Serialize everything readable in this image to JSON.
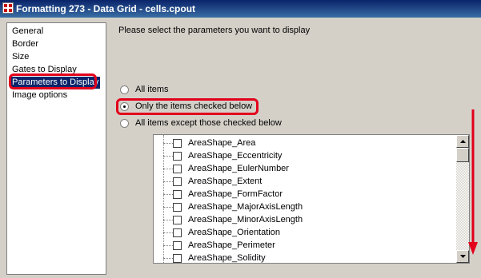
{
  "window": {
    "title": "Formatting 273 - Data Grid - cells.cpout"
  },
  "sidebar": {
    "items": [
      {
        "label": "General"
      },
      {
        "label": "Border"
      },
      {
        "label": "Size"
      },
      {
        "label": "Gates to Display"
      },
      {
        "label": "Parameters to Display",
        "selected": true
      },
      {
        "label": "Image options"
      }
    ]
  },
  "main": {
    "instruction": "Please select the parameters you want to display",
    "radio_options": [
      {
        "label": "All items",
        "checked": false
      },
      {
        "label": "Only the items checked below",
        "checked": true
      },
      {
        "label": "All items except those checked below",
        "checked": false
      }
    ],
    "parameters": [
      {
        "label": "AreaShape_Area",
        "checked": false
      },
      {
        "label": "AreaShape_Eccentricity",
        "checked": false
      },
      {
        "label": "AreaShape_EulerNumber",
        "checked": false
      },
      {
        "label": "AreaShape_Extent",
        "checked": false
      },
      {
        "label": "AreaShape_FormFactor",
        "checked": false
      },
      {
        "label": "AreaShape_MajorAxisLength",
        "checked": false
      },
      {
        "label": "AreaShape_MinorAxisLength",
        "checked": false
      },
      {
        "label": "AreaShape_Orientation",
        "checked": false
      },
      {
        "label": "AreaShape_Perimeter",
        "checked": false
      },
      {
        "label": "AreaShape_Solidity",
        "checked": false
      }
    ]
  },
  "colors": {
    "highlight": "#e3001b",
    "selection": "#0a246a",
    "titlebar": "#0a246a"
  },
  "icons": {
    "window": "app-icon",
    "scroll_up": "triangle-up-icon",
    "scroll_down": "triangle-down-icon",
    "annotation": "red-down-arrow-icon"
  }
}
